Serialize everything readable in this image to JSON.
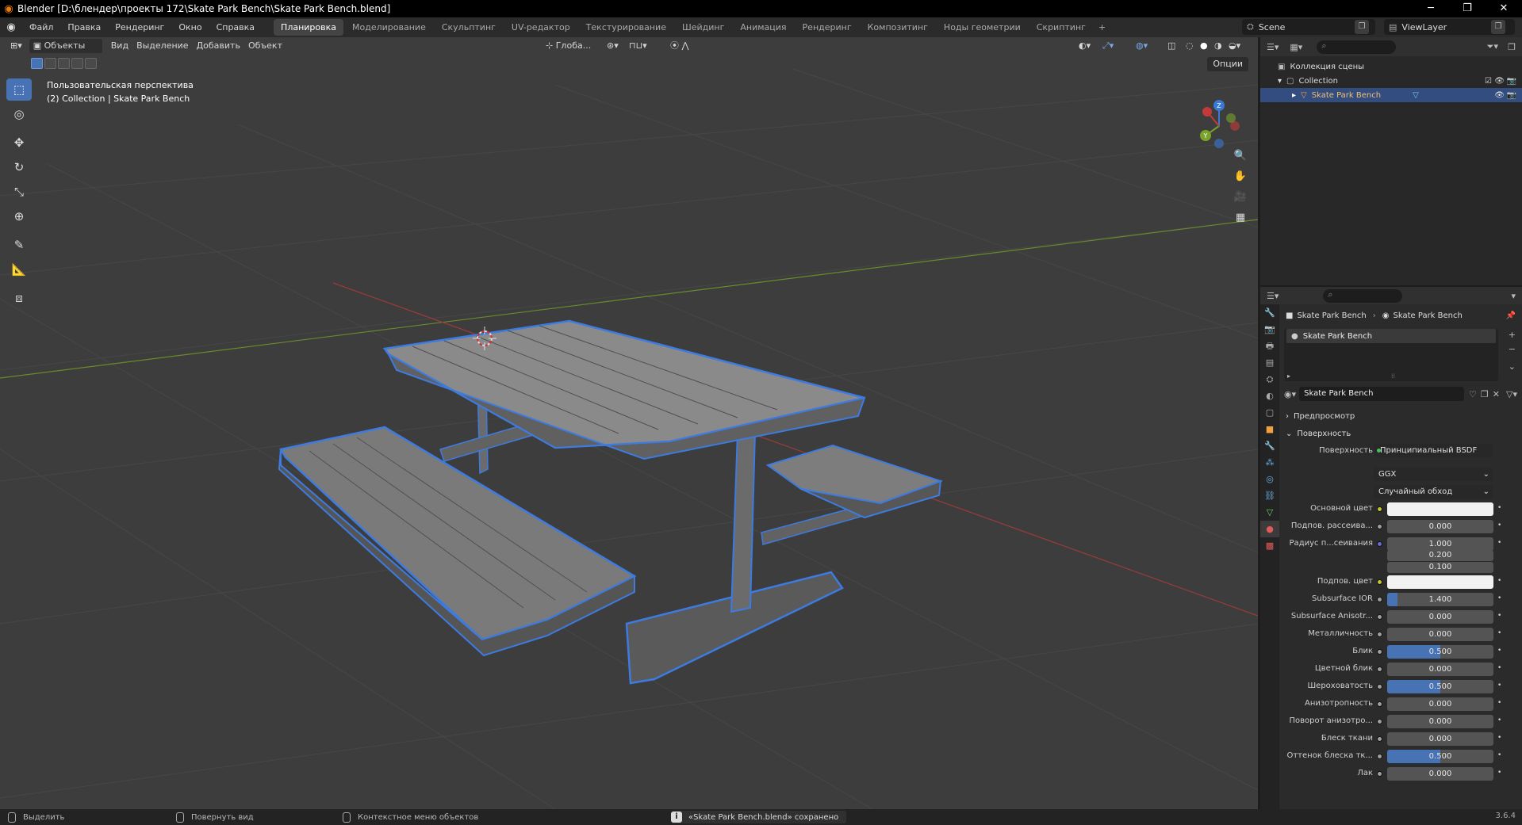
{
  "window": {
    "title": "Blender [D:\\блендер\\проекты 172\\Skate Park Bench\\Skate Park Bench.blend]",
    "minimize": "─",
    "maximize": "❐",
    "close": "✕"
  },
  "menu": [
    "Файл",
    "Правка",
    "Рендеринг",
    "Окно",
    "Справка"
  ],
  "workspaces": [
    "Планировка",
    "Моделирование",
    "Скульптинг",
    "UV-редактор",
    "Текстурирование",
    "Шейдинг",
    "Анимация",
    "Рендеринг",
    "Композитинг",
    "Ноды геометрии",
    "Скриптинг"
  ],
  "workspace_add": "+",
  "scene": {
    "name": "Scene",
    "view_layer": "ViewLayer"
  },
  "viewport": {
    "mode": "Объекты",
    "menus": [
      "Вид",
      "Выделение",
      "Добавить",
      "Объект"
    ],
    "transform_orientation": "Глоба...",
    "options": "Опции",
    "info_line1": "Пользовательская перспектива",
    "info_line2": "(2) Collection | Skate Park Bench"
  },
  "outliner": {
    "root": "Коллекция сцены",
    "collection": "Collection",
    "object": "Skate Park Bench"
  },
  "properties": {
    "breadcrumb_object": "Skate Park Bench",
    "breadcrumb_material": "Skate Park Bench",
    "slot": "Skate Park Bench",
    "material_name": "Skate Park Bench",
    "panel_preview": "Предпросмотр",
    "panel_surface": "Поверхность",
    "surface_label": "Поверхность",
    "surface_shader": "Принципиальный BSDF",
    "distribution": "GGX",
    "subsurface_method": "Случайный обход",
    "rows": [
      {
        "label": "Основной цвет",
        "value": "",
        "dot": "yellow",
        "kind": "color"
      },
      {
        "label": "Подпов. рассеива...",
        "value": "0.000",
        "dot": "gray",
        "kind": "num"
      },
      {
        "label": "Радиус п...сеивания",
        "value": "1.000",
        "dot": "blue",
        "kind": "num"
      },
      {
        "label": "",
        "value": "0.200",
        "dot": "",
        "kind": "num"
      },
      {
        "label": "",
        "value": "0.100",
        "dot": "",
        "kind": "num"
      },
      {
        "label": "Подпов. цвет",
        "value": "",
        "dot": "yellow",
        "kind": "color"
      },
      {
        "label": "Subsurface IOR",
        "value": "1.400",
        "dot": "gray",
        "kind": "num",
        "fill": 0.1
      },
      {
        "label": "Subsurface Anisotr...",
        "value": "0.000",
        "dot": "gray",
        "kind": "num"
      },
      {
        "label": "Металличность",
        "value": "0.000",
        "dot": "gray",
        "kind": "num"
      },
      {
        "label": "Блик",
        "value": "0.500",
        "dot": "gray",
        "kind": "num",
        "fill": 0.5
      },
      {
        "label": "Цветной блик",
        "value": "0.000",
        "dot": "gray",
        "kind": "num"
      },
      {
        "label": "Шероховатость",
        "value": "0.500",
        "dot": "gray",
        "kind": "num",
        "fill": 0.5
      },
      {
        "label": "Анизотропность",
        "value": "0.000",
        "dot": "gray",
        "kind": "num"
      },
      {
        "label": "Поворот анизотро...",
        "value": "0.000",
        "dot": "gray",
        "kind": "num"
      },
      {
        "label": "Блеск ткани",
        "value": "0.000",
        "dot": "gray",
        "kind": "num"
      },
      {
        "label": "Оттенок блеска тк...",
        "value": "0.500",
        "dot": "gray",
        "kind": "num",
        "fill": 0.5
      },
      {
        "label": "Лак",
        "value": "0.000",
        "dot": "gray",
        "kind": "num"
      }
    ]
  },
  "status": {
    "select": "Выделить",
    "rotate": "Повернуть вид",
    "context": "Контекстное меню объектов",
    "saved": "«Skate Park Bench.blend» сохранено",
    "version": "3.6.4"
  },
  "colors": {
    "accent": "#4772b3",
    "selection_outline": "#3d7be0",
    "bg": "#3d3d3d"
  }
}
